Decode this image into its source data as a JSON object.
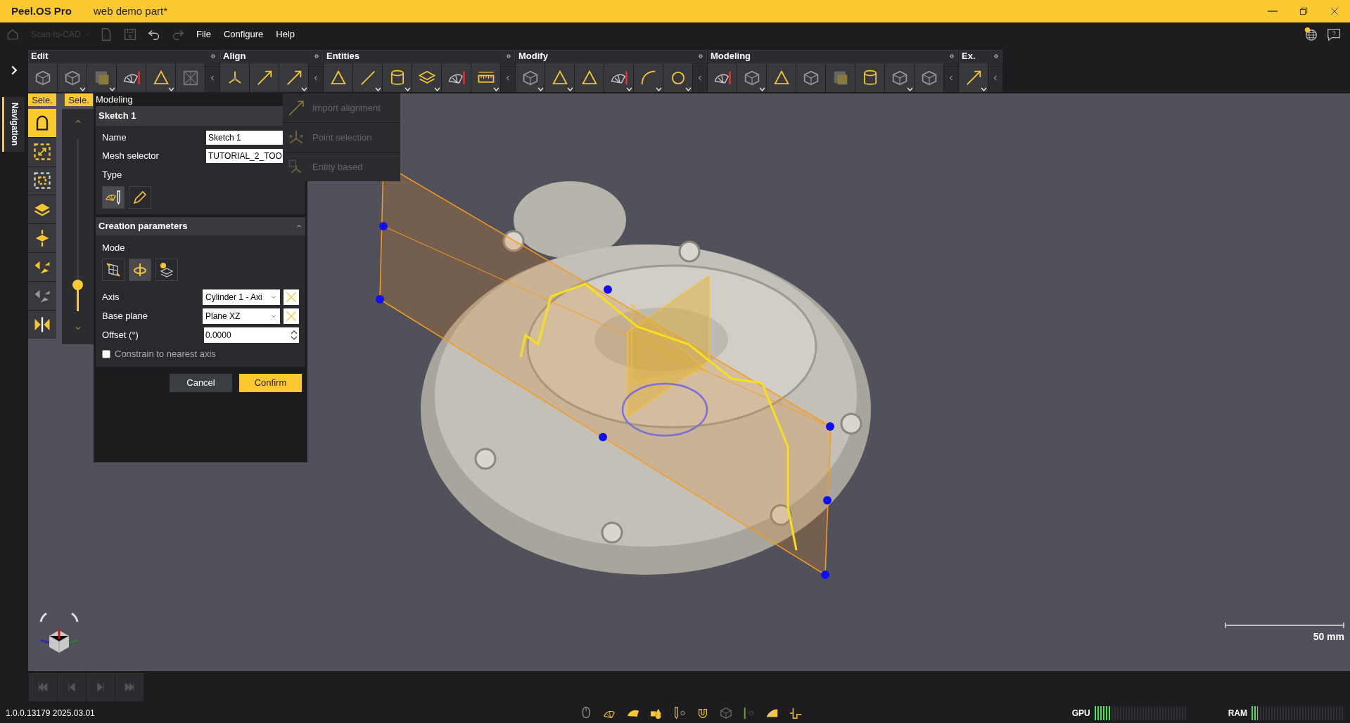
{
  "window": {
    "app": "Peel.OS Pro",
    "title": "web demo part*"
  },
  "menubar": {
    "workspace": "Scan-to-CAD",
    "menus": [
      "File",
      "Configure",
      "Help"
    ]
  },
  "toolbar": [
    {
      "label": "Edit",
      "buttons": [
        {
          "dropdown": false
        },
        {
          "dropdown": true
        },
        {
          "dropdown": true
        },
        {
          "dropdown": false
        },
        {
          "dropdown": true
        },
        {
          "dropdown": false
        }
      ]
    },
    {
      "label": "Align",
      "buttons": [
        {
          "dropdown": false
        },
        {
          "dropdown": false
        },
        {
          "dropdown": true
        }
      ]
    },
    {
      "label": "Entities",
      "buttons": [
        {
          "dropdown": false
        },
        {
          "dropdown": true
        },
        {
          "dropdown": true
        },
        {
          "dropdown": true
        },
        {
          "dropdown": false
        },
        {
          "dropdown": true
        }
      ]
    },
    {
      "label": "Modify",
      "buttons": [
        {
          "dropdown": true
        },
        {
          "dropdown": true
        },
        {
          "dropdown": false
        },
        {
          "dropdown": true
        },
        {
          "dropdown": true
        },
        {
          "dropdown": true
        }
      ]
    },
    {
      "label": "Modeling",
      "buttons": [
        {
          "dropdown": false
        },
        {
          "dropdown": true
        },
        {
          "dropdown": false
        },
        {
          "dropdown": false
        },
        {
          "dropdown": false
        },
        {
          "dropdown": false
        },
        {
          "dropdown": true
        },
        {
          "dropdown": false
        }
      ]
    },
    {
      "label": "Ex.",
      "buttons": [
        {
          "dropdown": true
        }
      ]
    }
  ],
  "align_menu": [
    {
      "label": "Import alignment",
      "disabled": true
    },
    {
      "label": "Point selection",
      "disabled": true
    },
    {
      "label": "Entity based",
      "disabled": true
    }
  ],
  "side_tab": "Navigation",
  "selection_tabs": [
    "Sele.",
    "Sele."
  ],
  "selection_tools": [
    {
      "selected": true
    },
    {
      "selected": false
    },
    {
      "selected": false
    },
    {
      "selected": false
    },
    {
      "selected": false
    },
    {
      "selected": false
    },
    {
      "selected": false
    },
    {
      "selected": false
    }
  ],
  "depth_slider": {
    "level": 0.15
  },
  "panel": {
    "tab": "Modeling",
    "section": "Sketch 1",
    "fields": [
      {
        "label": "Name",
        "value": "Sketch 1"
      },
      {
        "label": "Mesh selector",
        "value": "TUTORIAL_2_TOO"
      }
    ],
    "type_label": "Type",
    "type_buttons": [
      {
        "selected": true
      },
      {
        "selected": false
      }
    ],
    "creation": {
      "title": "Creation parameters",
      "expanded": true,
      "mode_label": "Mode",
      "mode_buttons": [
        {
          "selected": false
        },
        {
          "selected": true
        },
        {
          "selected": false
        }
      ],
      "axis": {
        "label": "Axis",
        "value": "Cylinder 1 - Axi"
      },
      "base_plane": {
        "label": "Base plane",
        "value": "Plane XZ"
      },
      "offset": {
        "label": "Offset (°)",
        "value": "0.0000"
      },
      "constrain": {
        "label": "Constrain to nearest axis",
        "checked": false
      }
    },
    "buttons": [
      "Cancel",
      "Confirm"
    ]
  },
  "scale_bar": "50 mm",
  "status": {
    "version": "1.0.0.13179 2025.03.01",
    "gpu": {
      "label": "GPU",
      "level": 0.17
    },
    "ram": {
      "label": "RAM",
      "level": 0.07
    }
  }
}
